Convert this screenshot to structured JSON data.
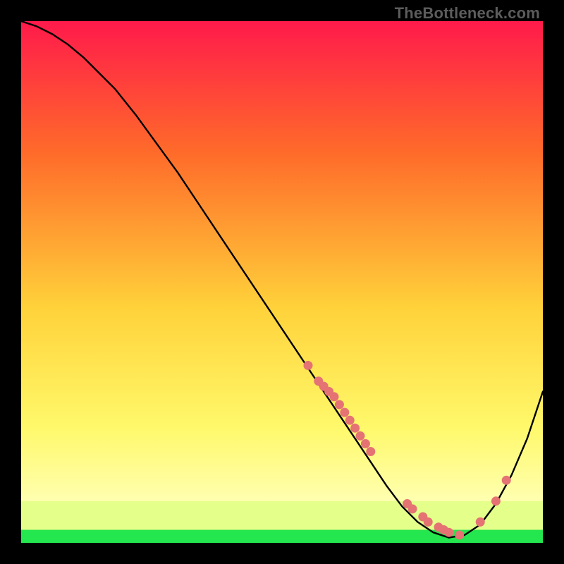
{
  "watermark": "TheBottleneck.com",
  "colors": {
    "black": "#000000",
    "curve": "#000000",
    "dot": "#e57373",
    "green": "#24e64e",
    "gradient_top": "#ff1a4b",
    "gradient_mid1": "#ff6a2a",
    "gradient_mid2": "#ffd23a",
    "gradient_mid3": "#fff96b",
    "gradient_bottom": "#ffffb0"
  },
  "chart_data": {
    "type": "line",
    "title": "",
    "xlabel": "",
    "ylabel": "",
    "xlim": [
      0,
      100
    ],
    "ylim": [
      0,
      100
    ],
    "x": [
      0,
      3,
      6,
      9,
      12,
      15,
      18,
      22,
      26,
      30,
      34,
      38,
      42,
      46,
      50,
      54,
      58,
      62,
      66,
      70,
      73,
      76,
      79,
      82,
      85,
      88,
      91,
      94,
      97,
      100
    ],
    "values": [
      100,
      99,
      97.5,
      95.5,
      93,
      90,
      87,
      82,
      76.5,
      71,
      65,
      59,
      53,
      47,
      41,
      35,
      29,
      23,
      17,
      11,
      7,
      4,
      2,
      1,
      1.5,
      3.5,
      7.5,
      13,
      20,
      29
    ],
    "dots_x": [
      55,
      57,
      58,
      59,
      60,
      61,
      62,
      63,
      64,
      65,
      66,
      67,
      74,
      75,
      77,
      78,
      80,
      81,
      82,
      84,
      88,
      91,
      93
    ],
    "dots_y": [
      34,
      31,
      30,
      29,
      28,
      26.5,
      25,
      23.5,
      22,
      20.5,
      19,
      17.5,
      7.5,
      6.5,
      5,
      4,
      3,
      2.5,
      2,
      1.5,
      4,
      8,
      12
    ],
    "green_band_y": [
      0,
      2.5
    ],
    "pale_band_y": [
      2.5,
      8
    ]
  }
}
